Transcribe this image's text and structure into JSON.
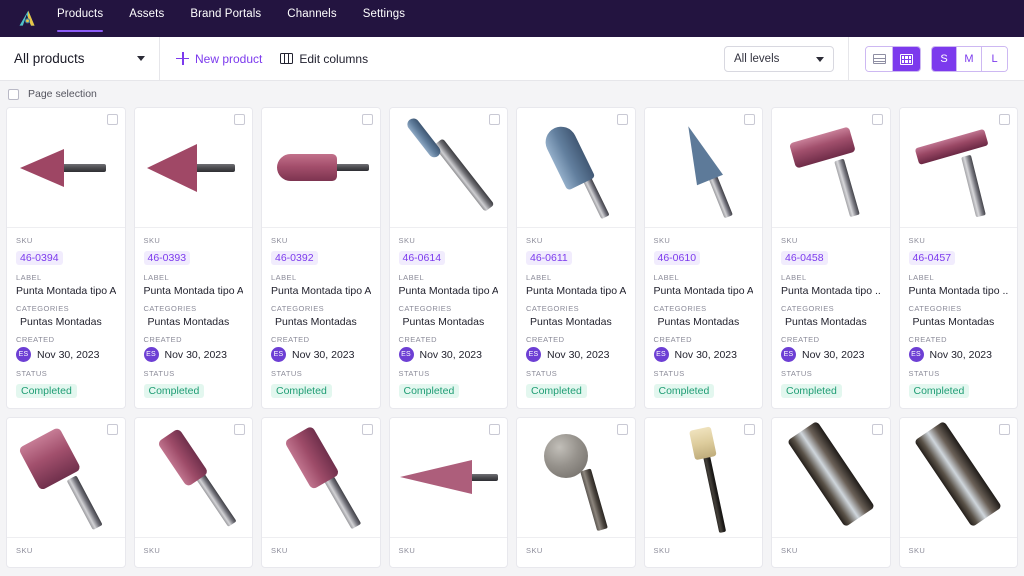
{
  "brand": {
    "logo_name": "akeneo-logo"
  },
  "nav": {
    "items": [
      {
        "label": "Products",
        "active": true
      },
      {
        "label": "Assets",
        "active": false
      },
      {
        "label": "Brand Portals",
        "active": false
      },
      {
        "label": "Channels",
        "active": false
      },
      {
        "label": "Settings",
        "active": false
      }
    ]
  },
  "toolbar": {
    "selector_label": "All products",
    "new_product_label": "New product",
    "edit_columns_label": "Edit columns",
    "levels_label": "All levels",
    "view_list_icon": "list-view-icon",
    "view_grid_icon": "grid-view-icon",
    "size_options": [
      {
        "label": "S",
        "active": true
      },
      {
        "label": "M",
        "active": false
      },
      {
        "label": "L",
        "active": false
      }
    ]
  },
  "selection": {
    "label": "Page selection"
  },
  "card_labels": {
    "sku": "SKU",
    "label": "LABEL",
    "categories": "CATEGORIES",
    "created": "CREATED",
    "status": "STATUS"
  },
  "colors": {
    "nav_background": "#231440",
    "accent": "#7c3aed",
    "sku_text": "#7c3aed",
    "sku_background": "#f1ecfd",
    "status_text": "#1f9d74",
    "status_background": "#e3f7ef",
    "page_background": "#f4f4f6",
    "avatar_background": "#6d3fd4"
  },
  "products": [
    {
      "sku": "46-0394",
      "label": "Punta Montada tipo A...",
      "categories": "Puntas Montadas",
      "created": "Nov 30, 2023",
      "avatar": "ES",
      "status": "Completed",
      "art": "cone-left-pink"
    },
    {
      "sku": "46-0393",
      "label": "Punta Montada tipo A...",
      "categories": "Puntas Montadas",
      "created": "Nov 30, 2023",
      "avatar": "ES",
      "status": "Completed",
      "art": "cone-left-pink-big"
    },
    {
      "sku": "46-0392",
      "label": "Punta Montada tipo A...",
      "categories": "Puntas Montadas",
      "created": "Nov 30, 2023",
      "avatar": "ES",
      "status": "Completed",
      "art": "bullet-pink"
    },
    {
      "sku": "46-0614",
      "label": "Punta Montada tipo A...",
      "categories": "Puntas Montadas",
      "created": "Nov 30, 2023",
      "avatar": "ES",
      "status": "Completed",
      "art": "rod-blue-diagonal"
    },
    {
      "sku": "46-0611",
      "label": "Punta Montada tipo A...",
      "categories": "Puntas Montadas",
      "created": "Nov 30, 2023",
      "avatar": "ES",
      "status": "Completed",
      "art": "bullet-blue-diagonal"
    },
    {
      "sku": "46-0610",
      "label": "Punta Montada tipo A...",
      "categories": "Puntas Montadas",
      "created": "Nov 30, 2023",
      "avatar": "ES",
      "status": "Completed",
      "art": "cone-blue-diagonal"
    },
    {
      "sku": "46-0458",
      "label": "Punta Montada tipo ...",
      "categories": "Puntas Montadas",
      "created": "Nov 30, 2023",
      "avatar": "ES",
      "status": "Completed",
      "art": "disc-pink-thick"
    },
    {
      "sku": "46-0457",
      "label": "Punta Montada tipo ...",
      "categories": "Puntas Montadas",
      "created": "Nov 30, 2023",
      "avatar": "ES",
      "status": "Completed",
      "art": "disc-pink-thin"
    }
  ],
  "products_row2": [
    {
      "art": "drum-pink-wide"
    },
    {
      "art": "cyl-pink-diagonal"
    },
    {
      "art": "cyl-pink-diagonal2"
    },
    {
      "art": "taper-pink-horizontal"
    },
    {
      "art": "ball-stone"
    },
    {
      "art": "tan-tip-thin"
    },
    {
      "art": "carbide-bur-1"
    },
    {
      "art": "carbide-bur-2"
    }
  ]
}
